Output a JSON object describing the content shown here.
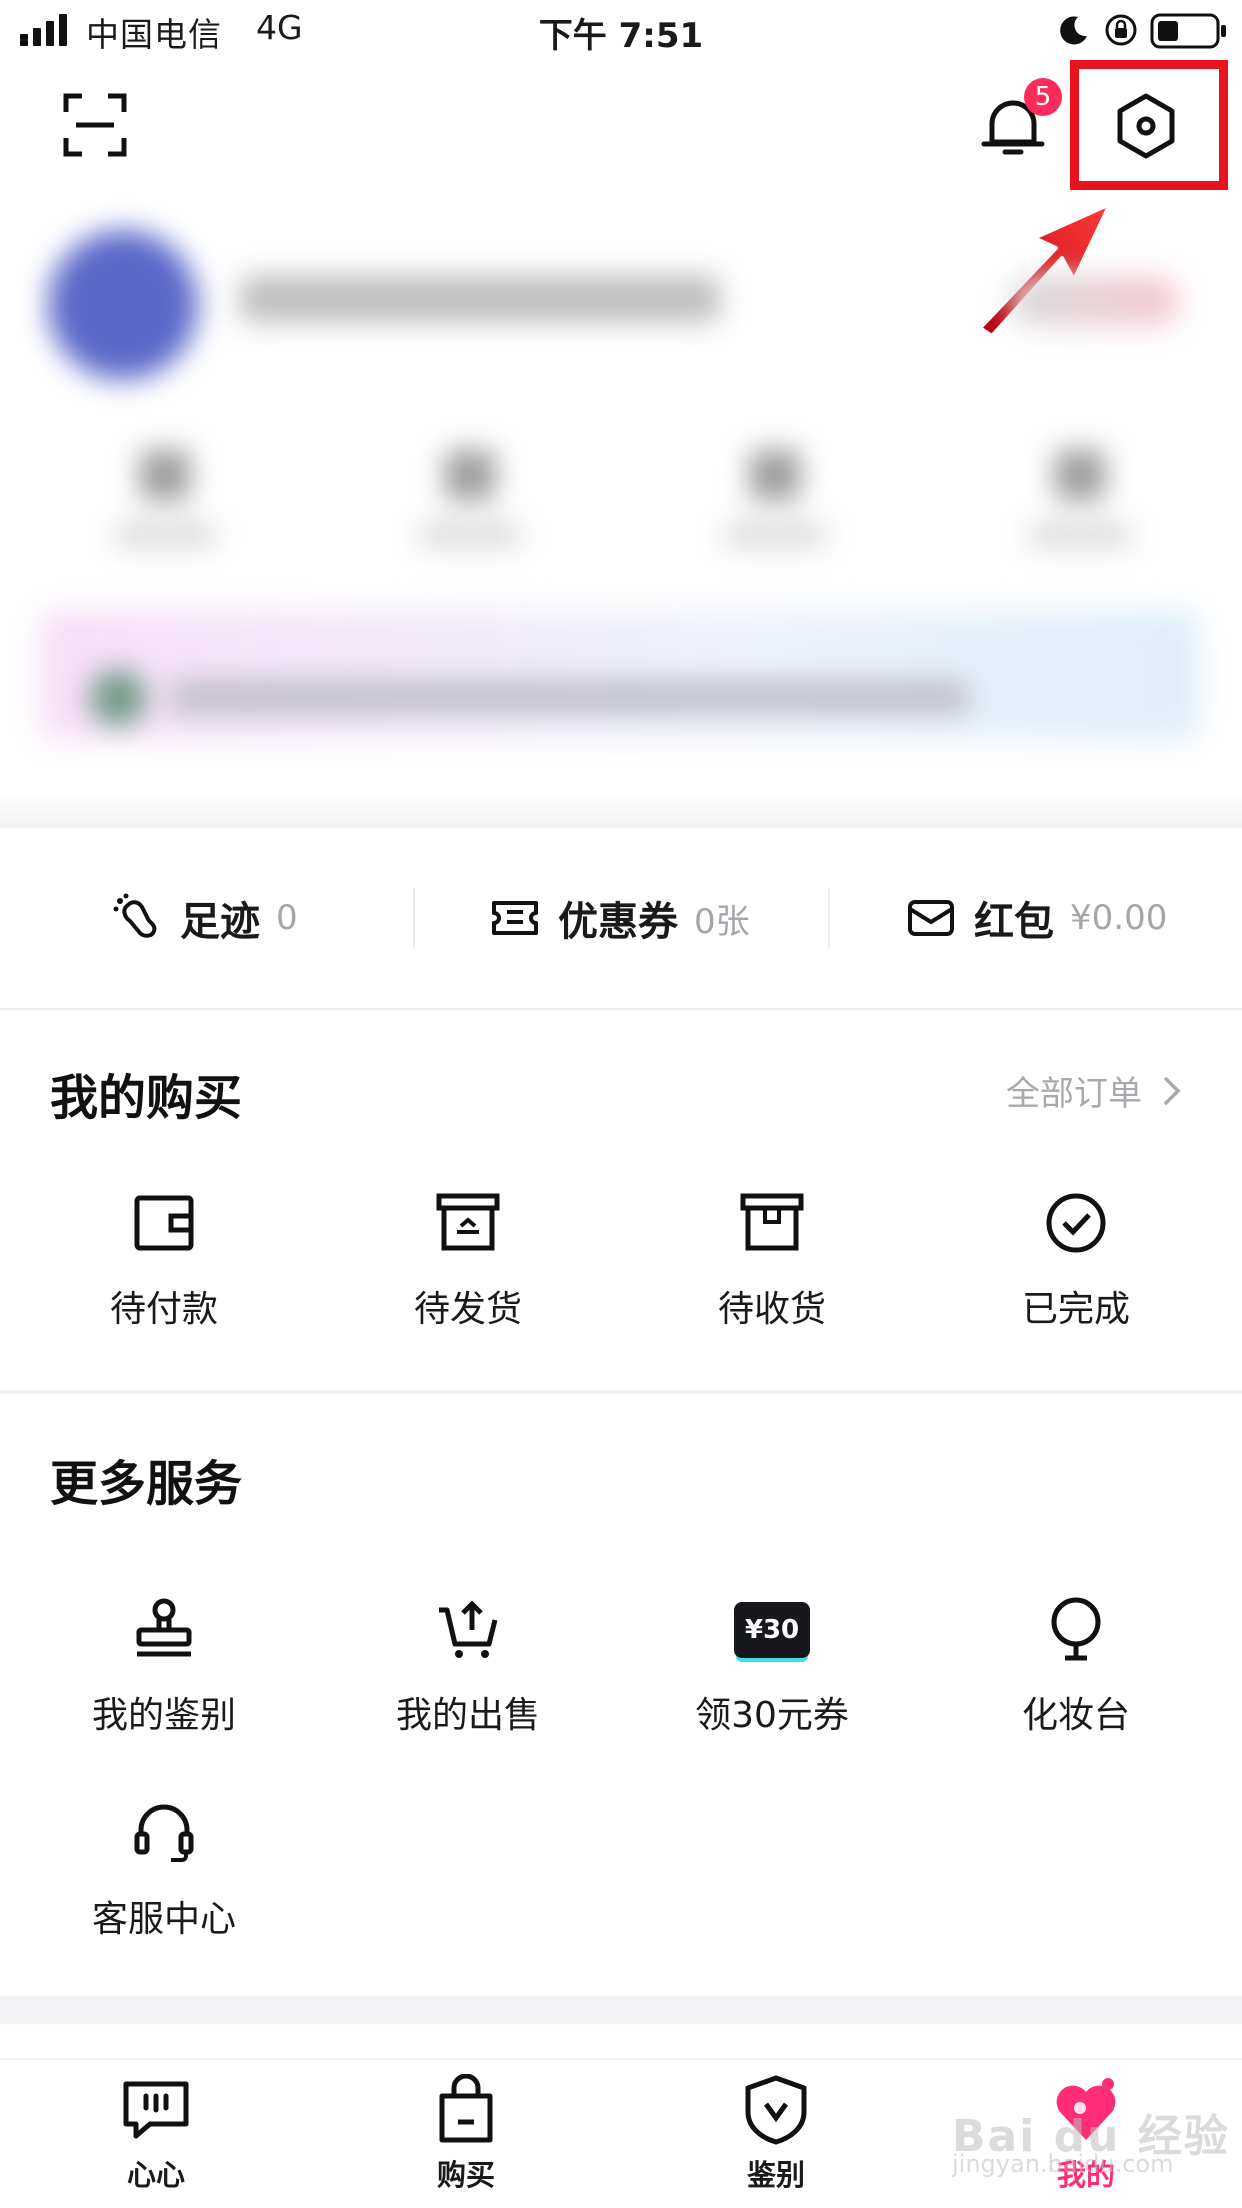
{
  "status_bar": {
    "carrier": "中国电信",
    "network": "4G",
    "time": "下午 7:51"
  },
  "top_bar": {
    "notification_count": "5"
  },
  "assets": [
    {
      "label": "足迹",
      "value": "0",
      "icon": "footprint-icon"
    },
    {
      "label": "优惠券",
      "value": "0张",
      "icon": "ticket-icon"
    },
    {
      "label": "红包",
      "value": "¥0.00",
      "icon": "envelope-icon"
    }
  ],
  "purchases": {
    "title": "我的购买",
    "all_orders": "全部订单",
    "items": [
      {
        "label": "待付款",
        "icon": "wallet-icon"
      },
      {
        "label": "待发货",
        "icon": "box-ship-icon"
      },
      {
        "label": "待收货",
        "icon": "box-receive-icon"
      },
      {
        "label": "已完成",
        "icon": "check-circle-icon"
      }
    ]
  },
  "services": {
    "title": "更多服务",
    "coupon_chip": "¥30",
    "items": [
      {
        "label": "我的鉴别",
        "icon": "stamp-icon"
      },
      {
        "label": "我的出售",
        "icon": "cart-upload-icon"
      },
      {
        "label": "领30元券",
        "icon": "coupon-icon"
      },
      {
        "label": "化妆台",
        "icon": "mirror-icon"
      },
      {
        "label": "客服中心",
        "icon": "headset-icon"
      }
    ]
  },
  "tabs": [
    {
      "label": "心心",
      "icon": "chat-icon"
    },
    {
      "label": "购买",
      "icon": "bag-icon"
    },
    {
      "label": "鉴别",
      "icon": "shield-icon"
    },
    {
      "label": "我的",
      "icon": "heart-icon"
    }
  ],
  "watermark": {
    "line1": "Bai du 经验",
    "line2": "jingyan.baidu.com"
  },
  "colors": {
    "accent_pink": "#ff2d78",
    "badge_red": "#ff2a5c",
    "annotation_red": "#e8131f"
  }
}
